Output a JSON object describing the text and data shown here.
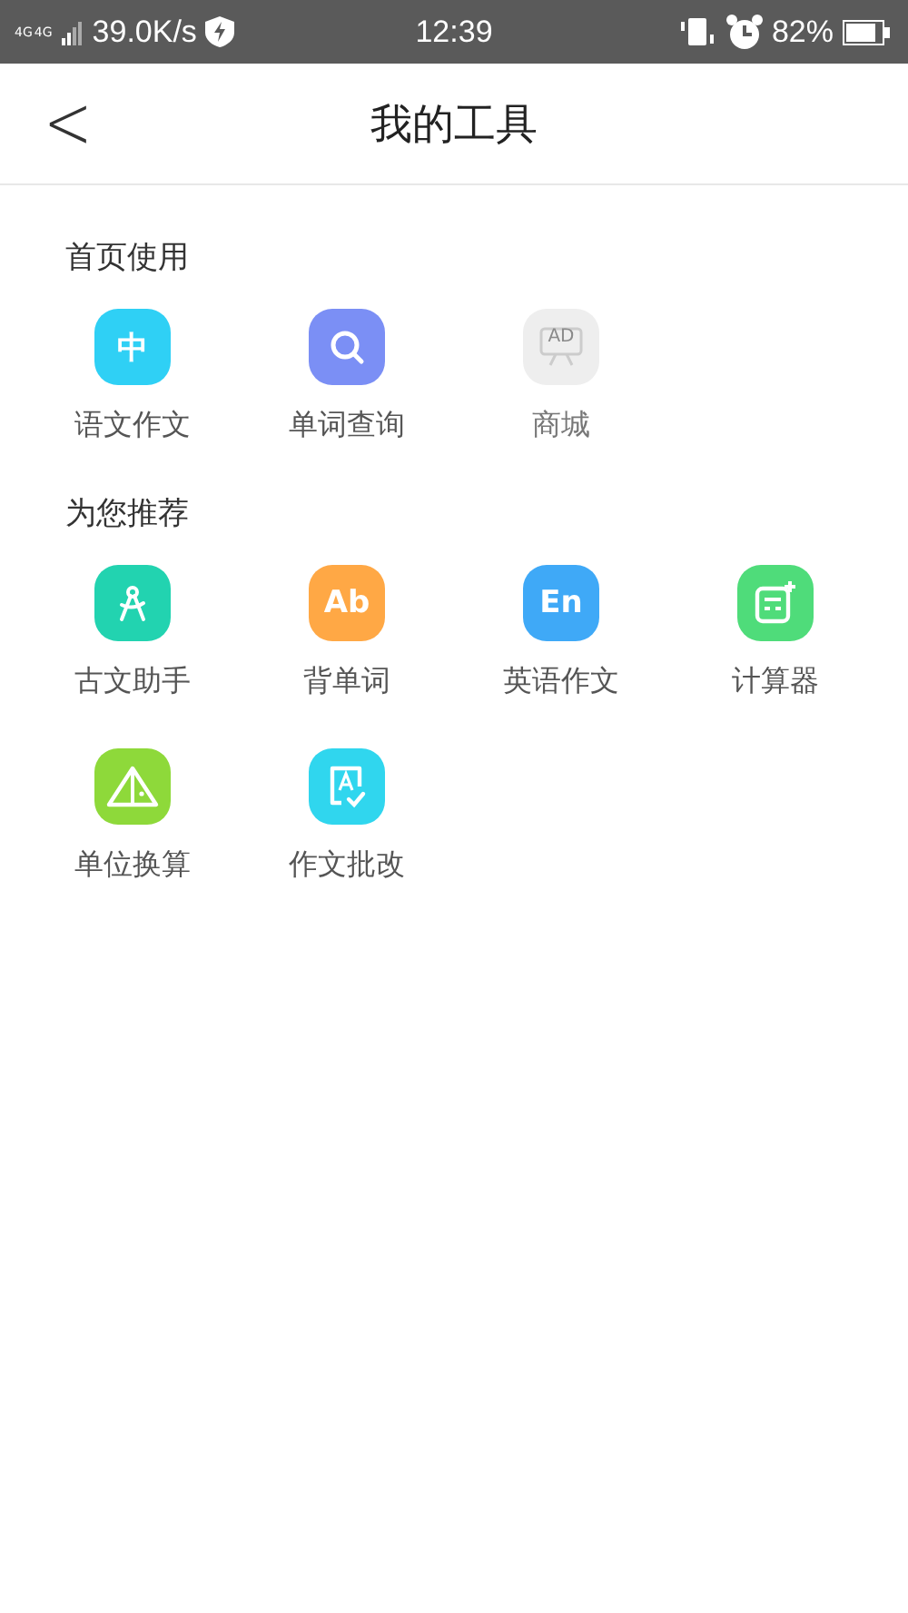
{
  "status_bar": {
    "network_labels": [
      "4G",
      "4G"
    ],
    "speed": "39.0K/s",
    "time": "12:39",
    "battery": "82%"
  },
  "header": {
    "back": "<",
    "title": "我的工具"
  },
  "sections": [
    {
      "title": "首页使用",
      "tools": [
        {
          "label": "语文作文",
          "kind": "glyph",
          "glyph": "中",
          "color": "#2fd0f5",
          "disabled": false
        },
        {
          "label": "单词查询",
          "kind": "search",
          "color": "#7b8ff5",
          "disabled": false
        },
        {
          "label": "商城",
          "kind": "ad",
          "glyph": "AD",
          "color": "#eeeeee",
          "disabled": true
        }
      ]
    },
    {
      "title": "为您推荐",
      "tools": [
        {
          "label": "古文助手",
          "kind": "compass",
          "color": "#22d3b0",
          "disabled": false
        },
        {
          "label": "背单词",
          "kind": "glyph",
          "glyph": "Ab",
          "color": "#ffa845",
          "disabled": false
        },
        {
          "label": "英语作文",
          "kind": "glyph",
          "glyph": "En",
          "color": "#3fa9f7",
          "disabled": false
        },
        {
          "label": "计算器",
          "kind": "calculator",
          "color": "#4fdc7a",
          "disabled": false
        },
        {
          "label": "单位换算",
          "kind": "triangle",
          "color": "#8ed93a",
          "disabled": false
        },
        {
          "label": "作文批改",
          "kind": "essay",
          "color": "#30d6ee",
          "disabled": false
        }
      ]
    }
  ]
}
